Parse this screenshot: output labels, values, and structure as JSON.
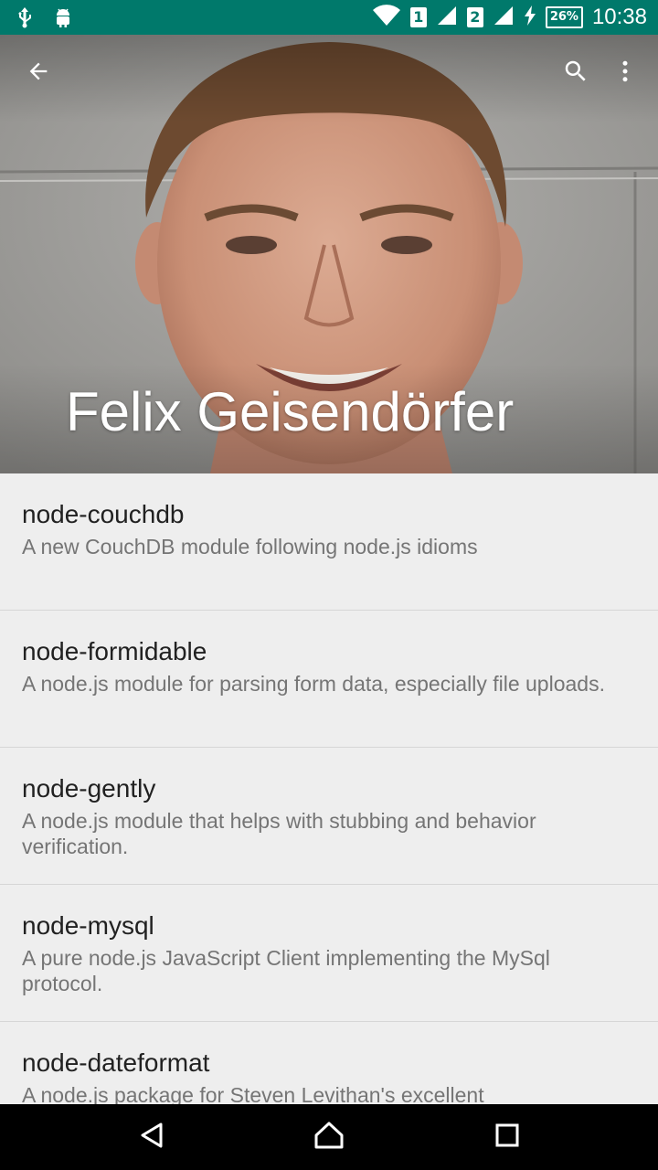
{
  "status_bar": {
    "time": "10:38",
    "battery": "26%",
    "sim1": "1",
    "sim2": "2",
    "icons": [
      "usb-icon",
      "android-debug-icon",
      "wifi-icon",
      "signal-icon",
      "charging-icon",
      "battery-icon"
    ]
  },
  "colors": {
    "status_bar": "#00796b",
    "list_background": "#eeeeee",
    "title_text": "#212121",
    "secondary_text": "#757575"
  },
  "toolbar": {
    "back_icon": "arrow-back-icon",
    "search_icon": "search-icon",
    "more_icon": "more-vert-icon"
  },
  "profile": {
    "name": "Felix Geisendörfer"
  },
  "repos": [
    {
      "name": "node-couchdb",
      "description": "A new CouchDB module following node.js idioms"
    },
    {
      "name": "node-formidable",
      "description": "A node.js module for parsing form data, especially file uploads."
    },
    {
      "name": "node-gently",
      "description": "A node.js module that helps with stubbing and behavior verification."
    },
    {
      "name": "node-mysql",
      "description": "A pure node.js JavaScript Client implementing the MySql protocol."
    },
    {
      "name": "node-dateformat",
      "description": "A node.js package for Steven Levithan's excellent"
    }
  ],
  "nav_bar": {
    "icons": [
      "nav-back-icon",
      "nav-home-icon",
      "nav-recents-icon"
    ]
  }
}
